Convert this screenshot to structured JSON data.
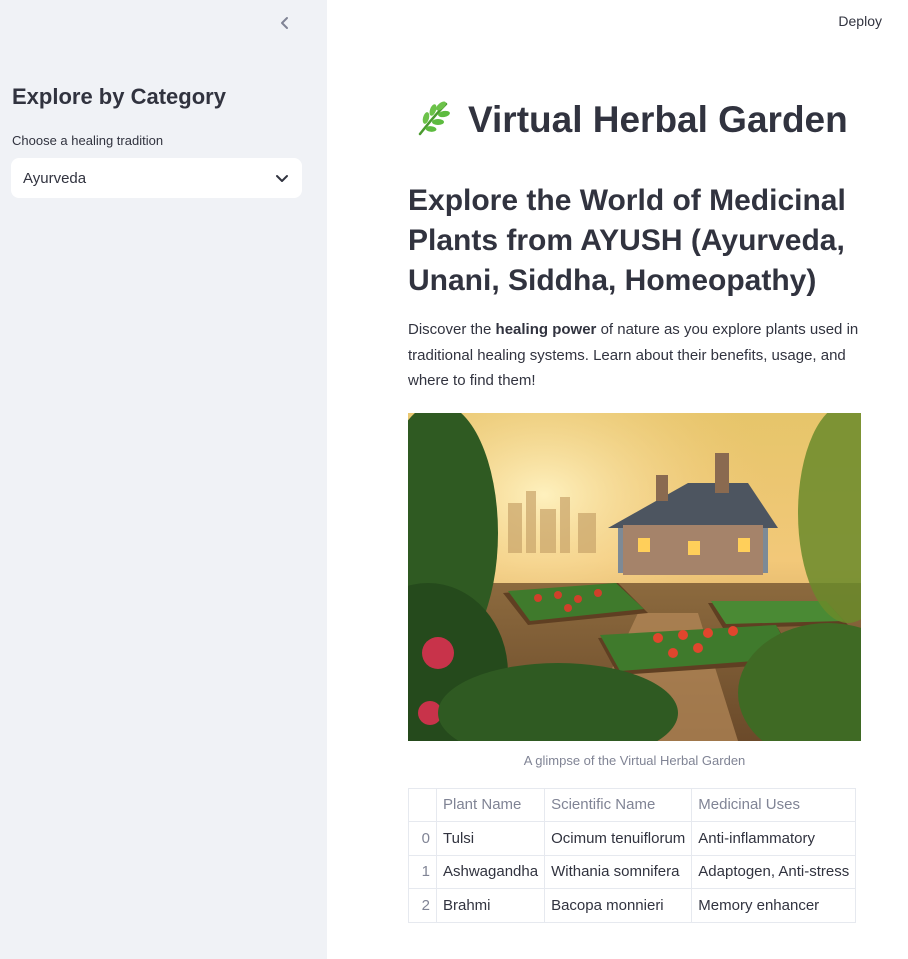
{
  "sidebar": {
    "collapse_icon": "chevron-left-icon",
    "title": "Explore by Category",
    "select_label": "Choose a healing tradition",
    "select_value": "Ayurveda",
    "select_icon": "chevron-down-icon"
  },
  "header": {
    "deploy_label": "Deploy"
  },
  "main": {
    "title_icon": "herb-leaf-icon",
    "title": "Virtual Herbal Garden",
    "subtitle": "Explore the World of Medicinal Plants from AYUSH (Ayurveda, Unani, Siddha, Homeopathy)",
    "intro_before": "Discover the ",
    "intro_bold": "healing power",
    "intro_after": " of nature as you explore plants used in traditional healing systems. Learn about their benefits, usage, and where to find them!",
    "image_caption": "A glimpse of the Virtual Herbal Garden",
    "table": {
      "columns": [
        "",
        "Plant Name",
        "Scientific Name",
        "Medicinal Uses"
      ],
      "rows": [
        [
          "0",
          "Tulsi",
          "Ocimum tenuiflorum",
          "Anti-inflammatory"
        ],
        [
          "1",
          "Ashwagandha",
          "Withania somnifera",
          "Adaptogen, Anti-stress"
        ],
        [
          "2",
          "Brahmi",
          "Bacopa monnieri",
          "Memory enhancer"
        ]
      ]
    }
  },
  "colors": {
    "sidebar_bg": "#f0f2f6",
    "text": "#31333f",
    "muted": "#808495",
    "leaf": "#5dbb3f"
  }
}
